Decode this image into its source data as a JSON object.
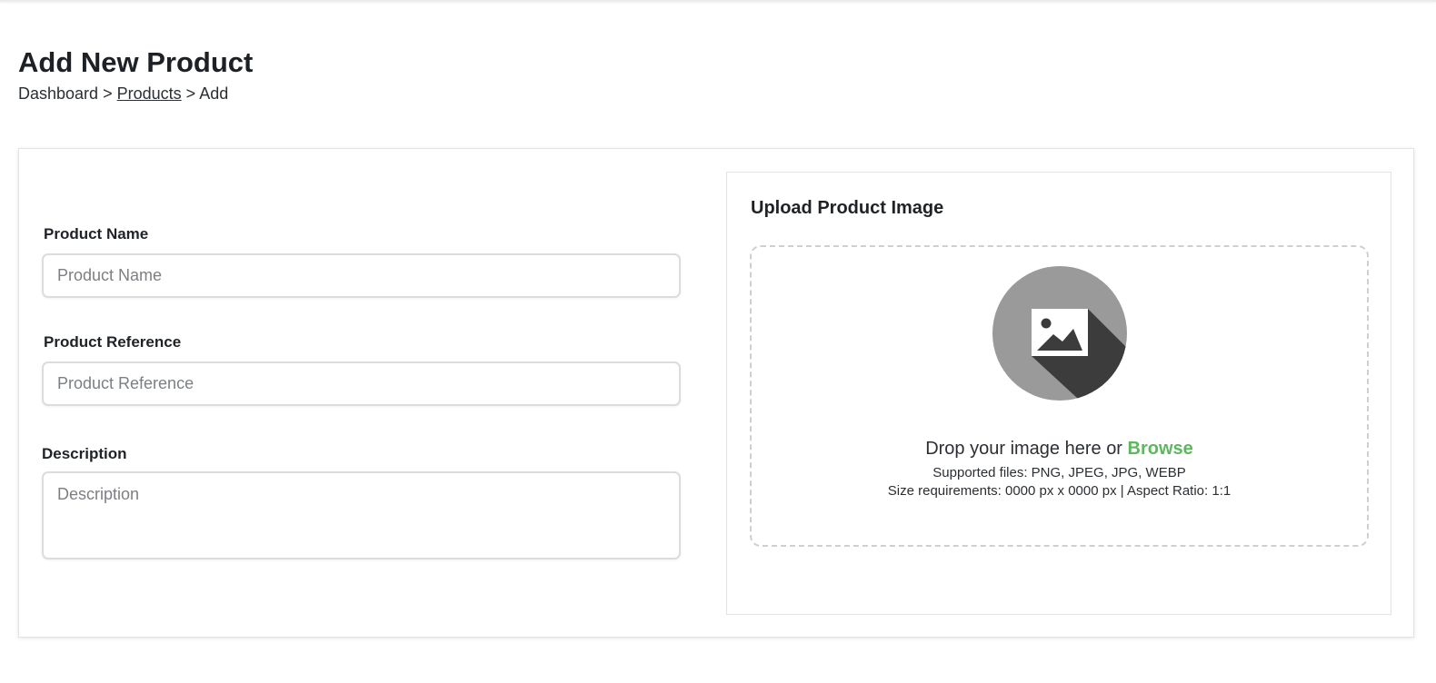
{
  "page": {
    "title": "Add New Product",
    "breadcrumb": {
      "home": "Dashboard",
      "separator": ">",
      "section": "Products",
      "current": "Add"
    }
  },
  "form": {
    "product_name": {
      "label": "Product Name",
      "placeholder": "Product Name",
      "value": ""
    },
    "product_reference": {
      "label": "Product Reference",
      "placeholder": "Product Reference",
      "value": ""
    },
    "description": {
      "label": "Description",
      "placeholder": "Description",
      "value": ""
    }
  },
  "upload": {
    "title": "Upload Product Image",
    "icon": "image-placeholder-icon",
    "drop_text": "Drop your image here or",
    "browse_label": "Browse",
    "supported_files": "Supported files: PNG, JPEG, JPG, WEBP",
    "size_requirements": "Size requirements: 0000 px x 0000 px | Aspect Ratio: 1:1"
  },
  "colors": {
    "accent_green": "#5cb85c",
    "icon_circle": "#9a9a9a",
    "icon_shadow": "#3c3c3c"
  }
}
